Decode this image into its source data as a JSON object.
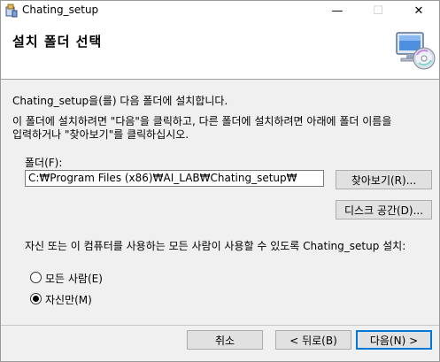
{
  "window": {
    "title": "Chating_setup",
    "minimize_glyph": "—",
    "maximize_glyph": "☐",
    "close_glyph": "✕"
  },
  "banner": {
    "title": "설치 폴더 선택"
  },
  "content": {
    "intro": "Chating_setup을(를) 다음 폴더에 설치합니다.",
    "instruction_line1": "이 폴더에 설치하려면 \"다음\"을 클릭하고, 다른 폴더에 설치하려면 아래에 폴더 이름을",
    "instruction_line2": "입력하거나 \"찾아보기\"를 클릭하십시오.",
    "folder_label": "폴더(F):",
    "folder_value": "C:₩Program Files (x86)₩AI_LAB₩Chating_setup₩",
    "browse_button": "찾아보기(R)...",
    "disk_space_button": "디스크 공간(D)...",
    "install_for_prompt": "자신 또는 이 컴퓨터를 사용하는 모든 사람이 사용할 수 있도록 Chating_setup 설치:",
    "radio_everyone": "모든 사람(E)",
    "radio_just_me": "자신만(M)",
    "selected_option": "just_me"
  },
  "footer": {
    "cancel_button": "취소",
    "back_button": "< 뒤로(B)",
    "next_button": "다음(N) >"
  }
}
